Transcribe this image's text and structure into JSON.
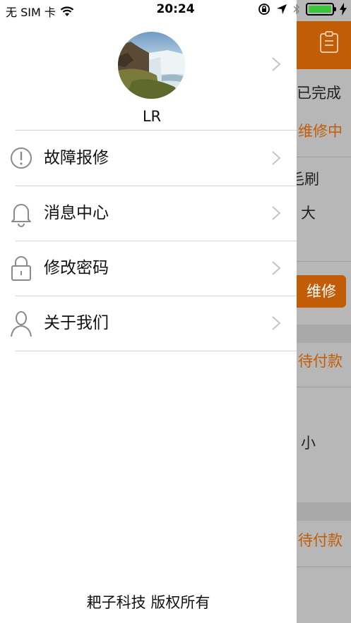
{
  "status_bar": {
    "carrier": "无 SIM 卡",
    "time": "20:24"
  },
  "profile": {
    "username": "LR"
  },
  "menu": [
    {
      "label": "故障报修",
      "icon": "alert-circle-icon"
    },
    {
      "label": "消息中心",
      "icon": "bell-icon"
    },
    {
      "label": "修改密码",
      "icon": "lock-icon"
    },
    {
      "label": "关于我们",
      "icon": "user-icon"
    }
  ],
  "footer": "耙子科技 版权所有",
  "background_page": {
    "texts": [
      "已完成",
      "维修中",
      "毛刷",
      "大",
      "维修",
      "待付款",
      "小",
      "待付款"
    ]
  },
  "colors": {
    "accent": "#c25d07",
    "battery": "#3cc43c"
  }
}
